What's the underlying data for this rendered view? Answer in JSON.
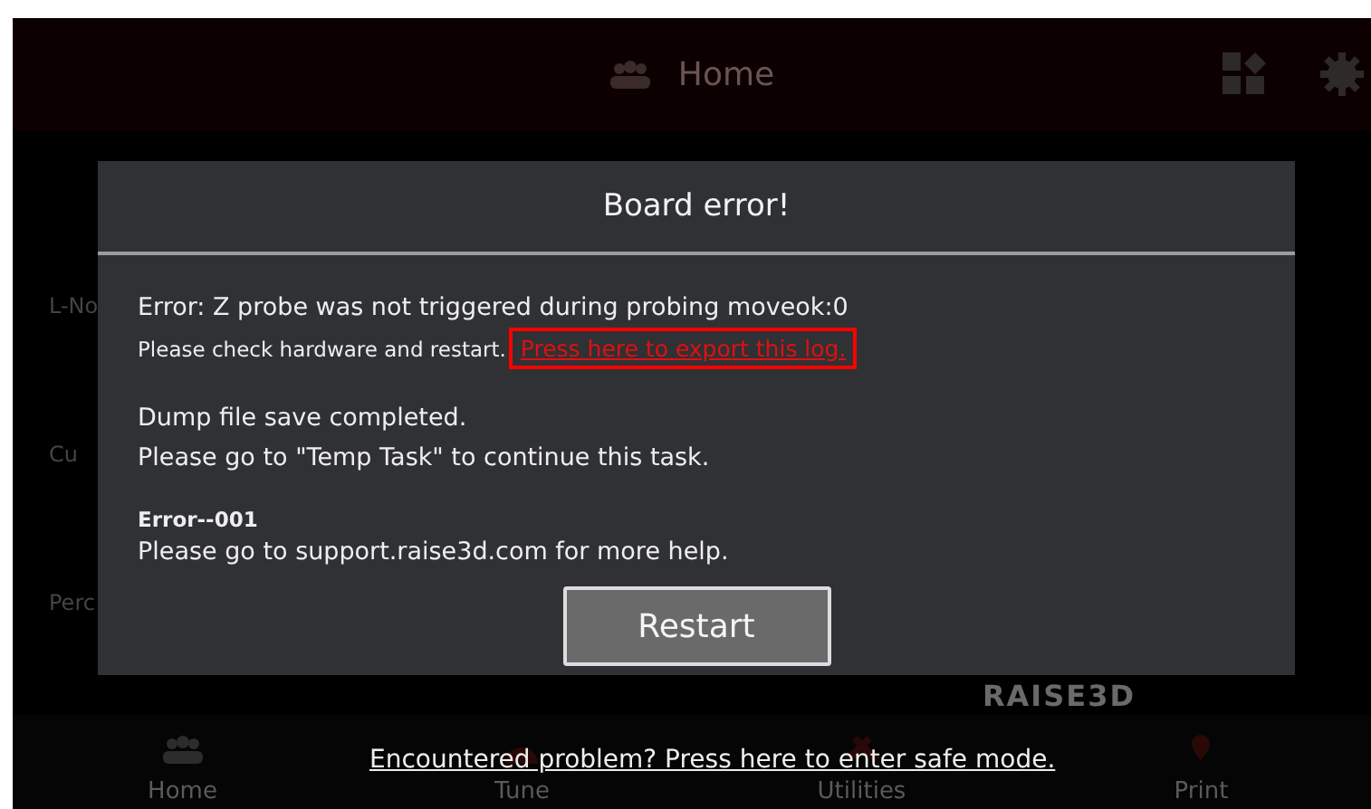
{
  "top_bar": {
    "title": "Home"
  },
  "background_labels": [
    "L-No",
    "Cu",
    "Perc"
  ],
  "brand": "RAISE3D",
  "nav": [
    {
      "label": "Home",
      "kind": "people"
    },
    {
      "label": "Tune",
      "kind": "dial"
    },
    {
      "label": "Utilities",
      "kind": "tools"
    },
    {
      "label": "Print",
      "kind": "pin"
    }
  ],
  "dialog": {
    "title": "Board error!",
    "error": "Error: Z probe was not triggered during probing moveok:0",
    "hint": "Please check hardware and restart.",
    "export_link": {
      "label": "Press here to export this log.",
      "outlined": true
    },
    "dump_lines": [
      "Dump file save completed.",
      "Please go to \"Temp Task\" to continue this task."
    ],
    "code": "Error--001",
    "help": "Please go to support.raise3d.com for more help.",
    "button": "Restart"
  },
  "safe_mode_link": "Encountered problem? Press here to enter safe mode."
}
